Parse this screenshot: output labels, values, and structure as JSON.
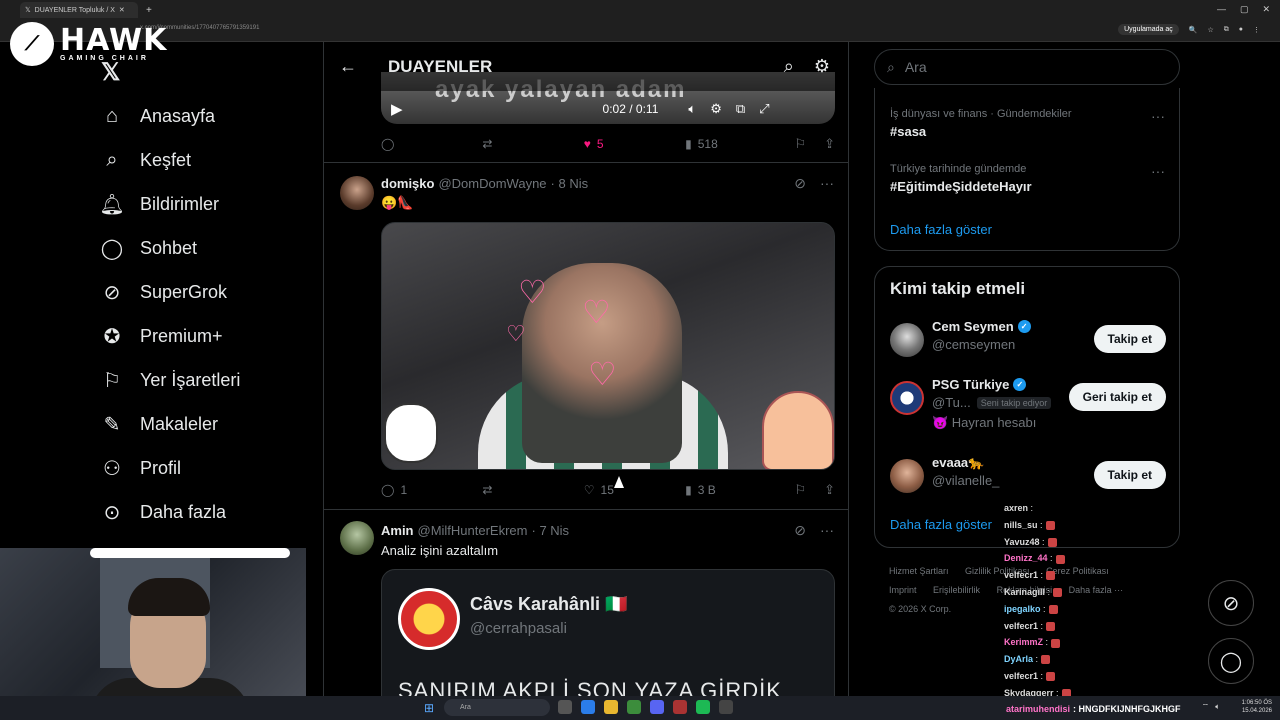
{
  "browser": {
    "tab_title": "DUAYENLER Topluluk / X",
    "url": "x.com/i/communities/1770407765791359191",
    "app_chip": "Uygulamada aç"
  },
  "logo": {
    "brand": "HAWK",
    "sub": "GAMING CHAIR"
  },
  "nav": {
    "items": [
      {
        "label": "Anasayfa",
        "icon": "home-icon"
      },
      {
        "label": "Keşfet",
        "icon": "search-icon"
      },
      {
        "label": "Bildirimler",
        "icon": "bell-icon"
      },
      {
        "label": "Sohbet",
        "icon": "chat-icon"
      },
      {
        "label": "SuperGrok",
        "icon": "grok-icon"
      },
      {
        "label": "Premium+",
        "icon": "verified-badge-icon"
      },
      {
        "label": "Yer İşaretleri",
        "icon": "bookmark-icon"
      },
      {
        "label": "Makaleler",
        "icon": "article-icon"
      },
      {
        "label": "Profil",
        "icon": "person-icon"
      },
      {
        "label": "Daha fazla",
        "icon": "more-circle-icon"
      }
    ]
  },
  "header": {
    "title": "DUAYENLER"
  },
  "video_top": {
    "subtitle": "ayak yalayan adam",
    "time": "0:02 / 0:11",
    "actions": {
      "replies": "",
      "reposts": "",
      "likes": "5",
      "views": "518"
    }
  },
  "post1": {
    "name": "domişko",
    "handle": "@DomDomWayne",
    "date": "· 8 Nis",
    "text": "😛👠",
    "actions": {
      "replies": "1",
      "reposts": "",
      "likes": "15",
      "views": "3 B"
    }
  },
  "post2": {
    "name": "Amin",
    "handle": "@MilfHunterEkrem",
    "date": "· 7 Nis",
    "text": "Analiz işini azaltalım",
    "quote": {
      "name": "Câvs Karahânli 🇮🇹",
      "handle": "@cerrahpasali",
      "text": "SANIRIM AKPLİ SON YAZA GİRDİK"
    }
  },
  "search": {
    "placeholder": "Ara"
  },
  "trends": [
    {
      "context": "İş dünyası ve finans · Gündemdekiler",
      "name": "#sasa"
    },
    {
      "context": "Türkiye tarihinde gündemde",
      "name": "#EğitimdeŞiddeteHayır"
    }
  ],
  "trends_show_more": "Daha fazla göster",
  "who_to_follow": {
    "title": "Kimi takip etmeli",
    "users": [
      {
        "name": "Cem Seymen",
        "handle": "@cemseymen",
        "verified": true,
        "button": "Takip et",
        "bio": "",
        "follows_you": ""
      },
      {
        "name": "PSG Türkiye",
        "handle": "@Tu...",
        "verified": true,
        "button": "Geri takip et",
        "bio": "😈 Hayran hesabı",
        "follows_you": "Seni takip ediyor"
      },
      {
        "name": "evaaa🐆",
        "handle": "@vilanelle_",
        "verified": false,
        "button": "Takip et",
        "bio": "",
        "follows_you": ""
      }
    ],
    "show_more": "Daha fazla göster"
  },
  "footer": {
    "links": [
      "Hizmet Şartları",
      "Gizlilik Politikası",
      "Çerez Politikası",
      "Imprint",
      "Erişilebilirlik",
      "Reklam bilgisi",
      "Daha fazla ···"
    ],
    "copyright": "© 2026 X Corp."
  },
  "chat": [
    {
      "user": "axren",
      "color": "white",
      "msg": ""
    },
    {
      "user": "nills_su",
      "color": "white",
      "msg": ""
    },
    {
      "user": "Yavuz48",
      "color": "white",
      "msg": ""
    },
    {
      "user": "Denizz_44",
      "color": "pink",
      "msg": ""
    },
    {
      "user": "velfecr1",
      "color": "white",
      "msg": ""
    },
    {
      "user": "Karinagill",
      "color": "white",
      "msg": ""
    },
    {
      "user": "ipegalko",
      "color": "cyan",
      "msg": ""
    },
    {
      "user": "velfecr1",
      "color": "white",
      "msg": ""
    },
    {
      "user": "KerimmZ",
      "color": "pink",
      "msg": ""
    },
    {
      "user": "DyArla",
      "color": "cyan",
      "msg": ""
    },
    {
      "user": "velfecr1",
      "color": "white",
      "msg": ""
    },
    {
      "user": "Skydaggerr",
      "color": "white",
      "msg": ""
    }
  ],
  "marquee": {
    "user": "atarimuhendisi",
    "msg": ": HNGDFKIJNHFGJKHGF"
  },
  "taskbar": {
    "search": "Ara",
    "time": "1:06:50 ÖS",
    "date": "15.04.2026"
  },
  "colors": {
    "accent": "#1d9bf0",
    "like": "#f91880",
    "bg": "#000000"
  }
}
